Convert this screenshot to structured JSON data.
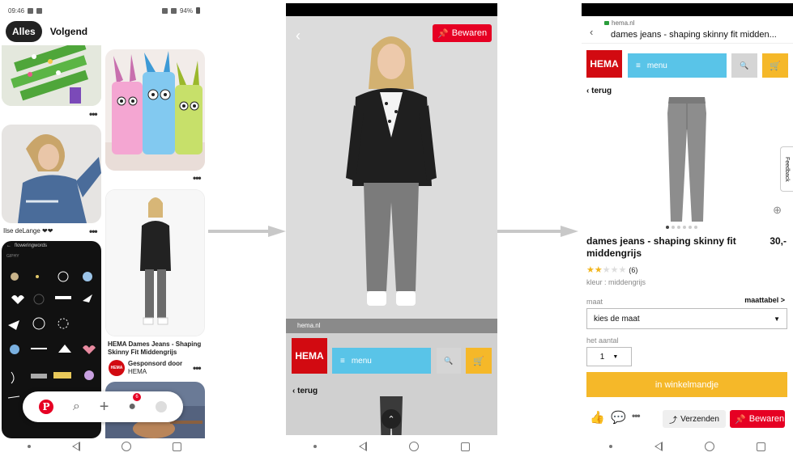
{
  "panel1": {
    "status": {
      "time": "09:46",
      "battery": "94%"
    },
    "tabs": {
      "all": "Alles",
      "following": "Volgend"
    },
    "pins": {
      "caption_person": "Ilse deLange ❤❤",
      "caption_product_line1": "HEMA Dames Jeans - Shaping",
      "caption_product_line2": "Skinny Fit Middengrijs",
      "sponsored_label": "Gesponsord door",
      "sponsor_name": "HEMA",
      "sponsor_logo": "HEMA",
      "more": "•••"
    },
    "flowering": {
      "title": "floweringwords",
      "giphy": "GIPHY"
    },
    "bottom_nav": {
      "notification_count": "6",
      "pinterest_icon": "pinterest-logo-icon",
      "search_icon": "search-icon",
      "add_icon": "plus-icon",
      "messages_icon": "chat-icon"
    }
  },
  "panel2": {
    "save_button": "Bewaren",
    "domain": "hema.nl",
    "hema_logo": "HEMA",
    "menu_label": "menu",
    "cart_count": "0",
    "back_link": "terug"
  },
  "panel3": {
    "url_domain": "hema.nl",
    "url_title": "dames jeans - shaping skinny fit midden...",
    "hema_logo": "HEMA",
    "menu_label": "menu",
    "cart_count": "0",
    "back_link": "terug",
    "feedback": "Feedback",
    "product_title": "dames jeans - shaping skinny fit middengrijs",
    "price": "30,-",
    "rating": {
      "value": 2,
      "max": 5,
      "count": "(6)"
    },
    "color_label": "kleur : middengrijs",
    "size_label": "maat",
    "size_chart": "maattabel >",
    "size_select": "kies de maat",
    "qty_label": "het aantal",
    "qty_value": "1",
    "add_to_cart": "in winkelmandje",
    "send_button": "Verzenden",
    "save_button": "Bewaren",
    "carousel": {
      "count": 6,
      "active": 1
    }
  },
  "colors": {
    "pinterest_red": "#e60023",
    "hema_red": "#d20a11",
    "hema_blue": "#59c4e8",
    "hema_yellow": "#f5b829"
  }
}
